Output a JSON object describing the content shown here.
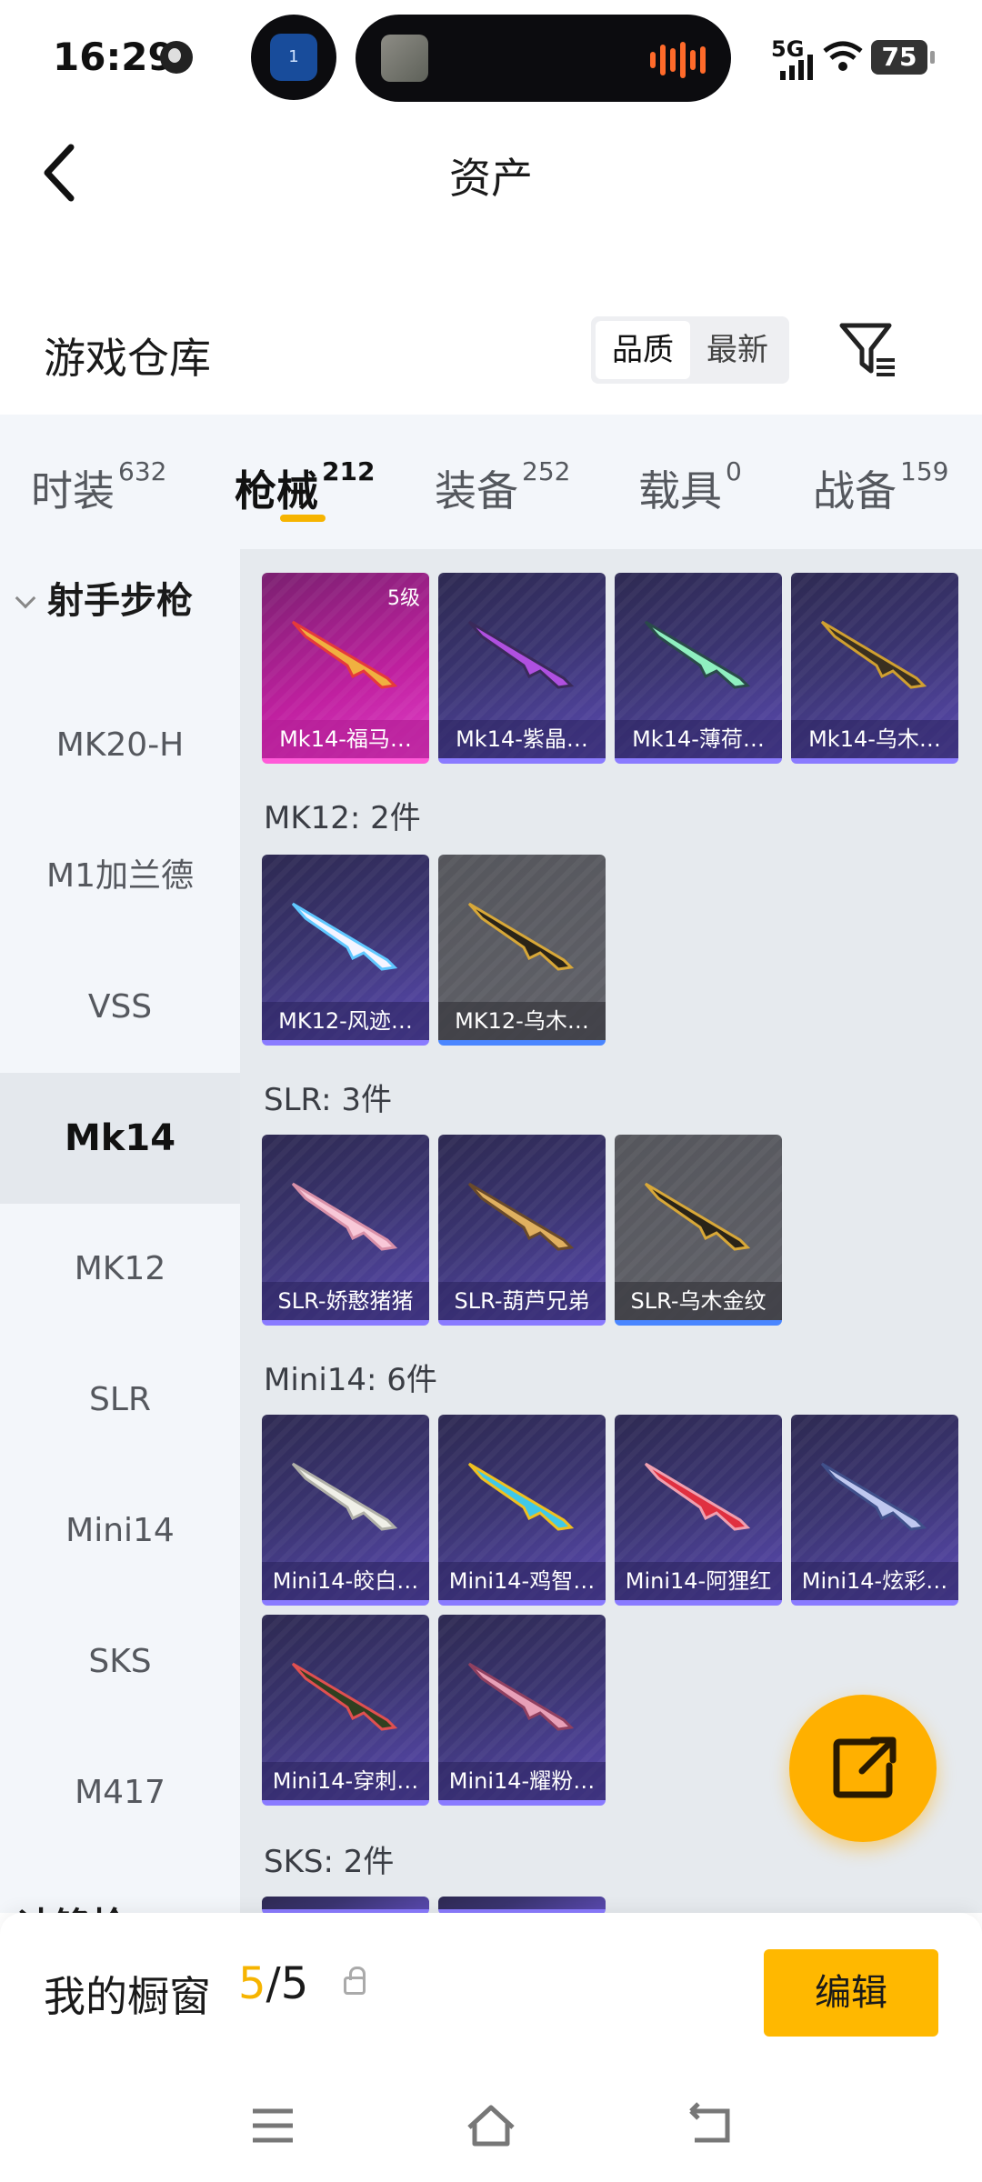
{
  "status_bar": {
    "time": "16:29",
    "network": "5G",
    "battery": "75",
    "mini_app_badge": "1",
    "icons": [
      "globe-icon",
      "broadcast-icon",
      "audio-wave-icon",
      "signal-icon",
      "wifi-icon",
      "battery-icon"
    ]
  },
  "header": {
    "title": "资产",
    "back_icon": "chevron-left-icon"
  },
  "warehouse": {
    "title": "游戏仓库",
    "sort_options": [
      "品质",
      "最新"
    ],
    "sort_selected": "品质",
    "filter_icon": "filter-icon"
  },
  "tabs": [
    {
      "label": "时装",
      "count": "632"
    },
    {
      "label": "枪械",
      "count": "212"
    },
    {
      "label": "装备",
      "count": "252"
    },
    {
      "label": "载具",
      "count": "0"
    },
    {
      "label": "战备",
      "count": "159"
    }
  ],
  "active_tab": "枪械",
  "sidebar": {
    "group": "射手步枪",
    "items": [
      "MK20-H",
      "M1加兰德",
      "VSS",
      "Mk14",
      "MK12",
      "SLR",
      "Mini14",
      "SKS",
      "M417"
    ],
    "active": "Mk14",
    "next_group_partial": "冲锋枪"
  },
  "groups": [
    {
      "label": "",
      "items": [
        {
          "name": "Mk14-福马…",
          "level": "5级",
          "style": "pink"
        },
        {
          "name": "Mk14-紫晶…",
          "style": "purple"
        },
        {
          "name": "Mk14-薄荷…",
          "style": "purple"
        },
        {
          "name": "Mk14-乌木…",
          "style": "purple"
        }
      ]
    },
    {
      "label": "MK12: 2件",
      "items": [
        {
          "name": "MK12-风迹…",
          "style": "purple"
        },
        {
          "name": "MK12-乌木…",
          "style": "gray"
        }
      ]
    },
    {
      "label": "SLR: 3件",
      "items": [
        {
          "name": "SLR-娇憨猪猪",
          "style": "purple"
        },
        {
          "name": "SLR-葫芦兄弟",
          "style": "purple"
        },
        {
          "name": "SLR-乌木金纹",
          "style": "gray"
        }
      ]
    },
    {
      "label": "Mini14: 6件",
      "items": [
        {
          "name": "Mini14-皎白…",
          "style": "purple"
        },
        {
          "name": "Mini14-鸡智…",
          "style": "purple"
        },
        {
          "name": "Mini14-阿狸红",
          "style": "purple"
        },
        {
          "name": "Mini14-炫彩…",
          "style": "purple"
        },
        {
          "name": "Mini14-穿刺…",
          "style": "purple"
        },
        {
          "name": "Mini14-耀粉…",
          "style": "purple"
        }
      ]
    },
    {
      "label": "SKS: 2件",
      "items": []
    }
  ],
  "fab_icon": "share-external-icon",
  "showcase": {
    "label": "我的橱窗",
    "current": "5",
    "total": "/5",
    "lock_icon": "lock-icon",
    "edit_label": "编辑"
  },
  "nav_bar": [
    "menu-icon",
    "home-icon",
    "back-icon"
  ],
  "colors": {
    "accent": "#ffb800",
    "tab_underline": "#f6b400",
    "card_purple": "#3a3470",
    "card_pink": "#c020a0",
    "card_gray": "#5e5f66"
  }
}
